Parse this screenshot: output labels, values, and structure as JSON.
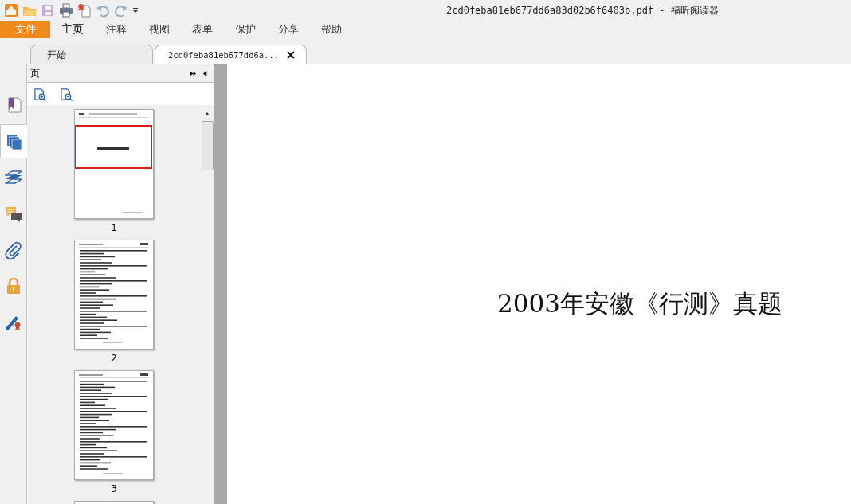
{
  "window": {
    "title": "2cd0feba81eb677dd6a83d02b6f6403b.pdf - 福昕阅读器"
  },
  "menu": {
    "file_button": "文件",
    "tabs": [
      {
        "label": "主页",
        "selected": true
      },
      {
        "label": "注释",
        "selected": false
      },
      {
        "label": "视图",
        "selected": false
      },
      {
        "label": "表单",
        "selected": false
      },
      {
        "label": "保护",
        "selected": false
      },
      {
        "label": "分享",
        "selected": false
      },
      {
        "label": "帮助",
        "selected": false
      }
    ]
  },
  "document_tabs": [
    {
      "label": "开始",
      "selected": false,
      "closable": false
    },
    {
      "label": "2cd0feba81eb677dd6a...",
      "selected": true,
      "closable": true
    }
  ],
  "side_rail": [
    {
      "kind": "bookmark",
      "selected": false
    },
    {
      "kind": "pages",
      "selected": true
    },
    {
      "kind": "layers",
      "selected": false
    },
    {
      "kind": "comments",
      "selected": false
    },
    {
      "kind": "attachments",
      "selected": false
    },
    {
      "kind": "security",
      "selected": false
    },
    {
      "kind": "signature",
      "selected": false
    }
  ],
  "panel": {
    "title": "页",
    "thumbnails": [
      {
        "number": "1",
        "kind": "cover",
        "selected": true
      },
      {
        "number": "2",
        "kind": "text",
        "selected": false
      },
      {
        "number": "3",
        "kind": "text",
        "selected": false
      },
      {
        "kind": "text"
      }
    ]
  },
  "document": {
    "heading": "2003年安徽《行测》真题"
  }
}
